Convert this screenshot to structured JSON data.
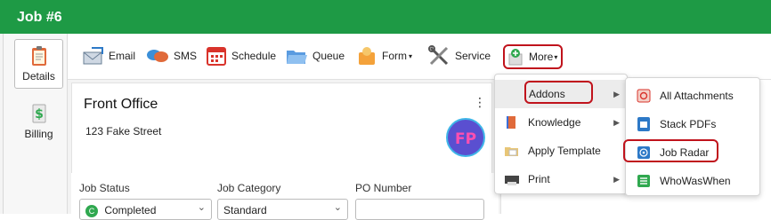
{
  "window": {
    "title": "Job #6"
  },
  "sidebar": {
    "items": [
      {
        "label": "Details",
        "icon": "clipboard-icon",
        "active": true
      },
      {
        "label": "Billing",
        "icon": "dollar-document-icon",
        "active": false
      }
    ]
  },
  "toolbar": {
    "email": "Email",
    "sms": "SMS",
    "schedule": "Schedule",
    "queue": "Queue",
    "form": "Form",
    "service": "Service",
    "more": "More"
  },
  "card": {
    "title": "Front Office",
    "address": "123 Fake Street",
    "logo_text": "FP"
  },
  "fields": {
    "job_status": {
      "label": "Job Status",
      "value": "Completed"
    },
    "job_category": {
      "label": "Job Category",
      "value": "Standard"
    },
    "po_number": {
      "label": "PO Number",
      "value": ""
    }
  },
  "more_menu": {
    "items": [
      {
        "label": "Addons"
      },
      {
        "label": "Knowledge"
      },
      {
        "label": "Apply Template"
      },
      {
        "label": "Print"
      }
    ]
  },
  "addons_menu": {
    "items": [
      {
        "label": "All Attachments"
      },
      {
        "label": "Stack PDFs"
      },
      {
        "label": "Job Radar"
      },
      {
        "label": "WhoWasWhen"
      }
    ]
  },
  "colors": {
    "brand_green": "#1e9a45",
    "highlight_red": "#c0131c"
  }
}
